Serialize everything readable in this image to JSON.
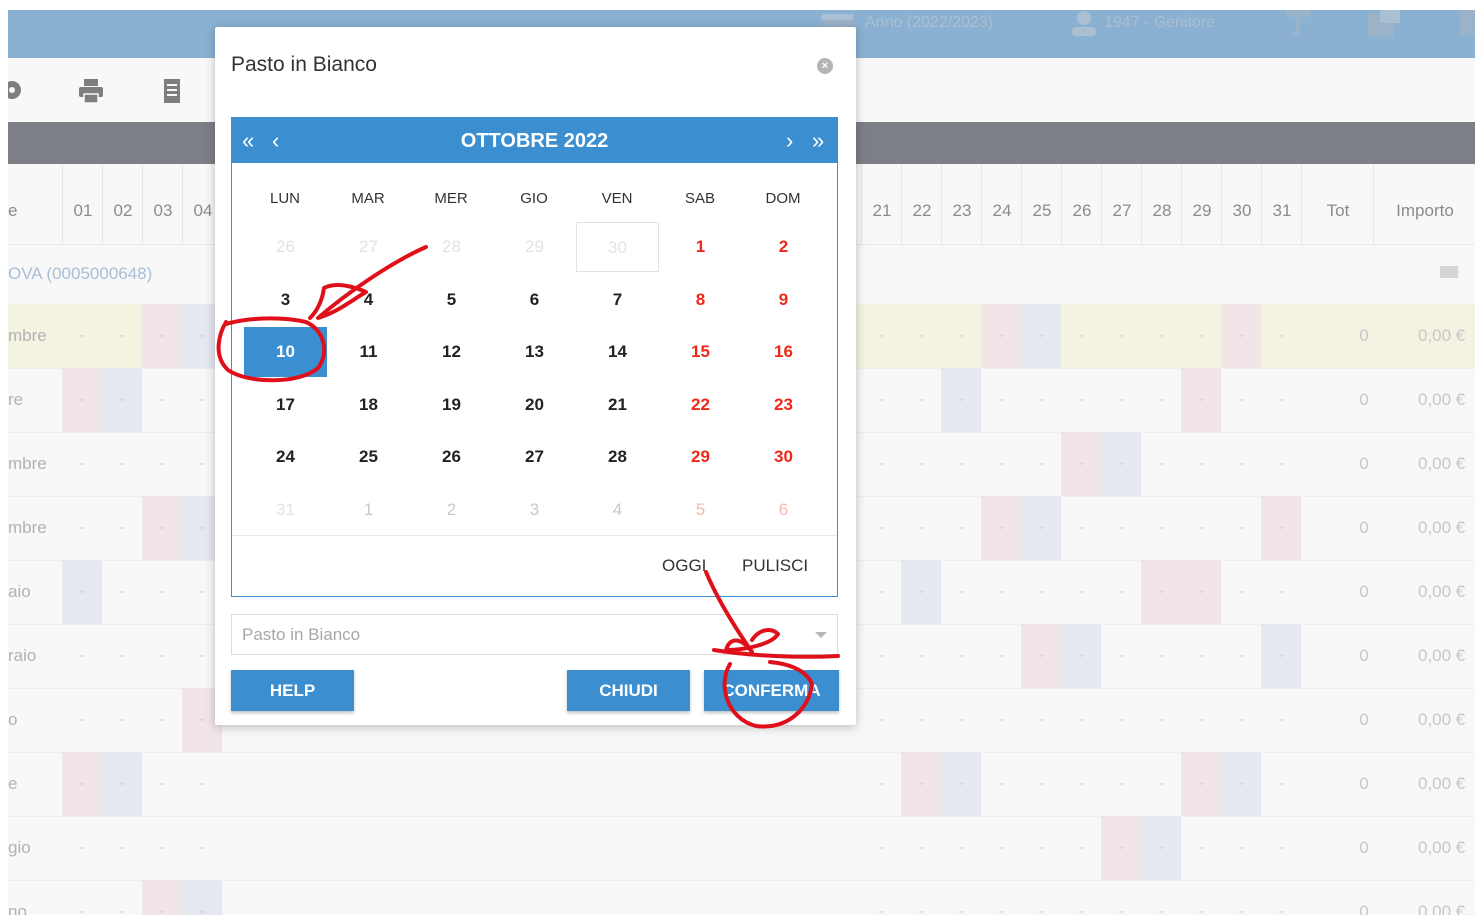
{
  "background": {
    "topbar": {
      "year": "Anno (2022/2023)",
      "user": "1947 - Genitore"
    },
    "grid": {
      "header_days": [
        "01",
        "02",
        "03",
        "04",
        "21",
        "22",
        "23",
        "24",
        "25",
        "26",
        "27",
        "28",
        "29",
        "30",
        "31"
      ],
      "header_label": "e",
      "tot_label": "Tot",
      "importo_label": "Importo",
      "student": "OVA (0005000648)",
      "rows": [
        {
          "label": "mbre",
          "tot": "0",
          "importo": "0,00 €"
        },
        {
          "label": "re",
          "tot": "0",
          "importo": "0,00 €"
        },
        {
          "label": "mbre",
          "tot": "0",
          "importo": "0,00 €"
        },
        {
          "label": "mbre",
          "tot": "0",
          "importo": "0,00 €"
        },
        {
          "label": "aio",
          "tot": "0",
          "importo": "0,00 €"
        },
        {
          "label": "raio",
          "tot": "0",
          "importo": "0,00 €"
        },
        {
          "label": "o",
          "tot": "0",
          "importo": "0,00 €"
        },
        {
          "label": "e",
          "tot": "0",
          "importo": "0,00 €"
        },
        {
          "label": "gio",
          "tot": "0",
          "importo": "0,00 €"
        },
        {
          "label": "no",
          "tot": "0",
          "importo": "0,00 €"
        }
      ],
      "dash": "-"
    }
  },
  "modal": {
    "title": "Pasto in Bianco",
    "close": "×",
    "calendar": {
      "month": "OTTOBRE 2022",
      "prev_year": "«",
      "prev_month": "‹",
      "next_month": "›",
      "next_year": "»",
      "weekdays": [
        "LUN",
        "MAR",
        "MER",
        "GIO",
        "VEN",
        "SAB",
        "DOM"
      ],
      "weeks": [
        [
          "26",
          "27",
          "28",
          "29",
          "30",
          "1",
          "2"
        ],
        [
          "3",
          "4",
          "5",
          "6",
          "7",
          "8",
          "9"
        ],
        [
          "10",
          "11",
          "12",
          "13",
          "14",
          "15",
          "16"
        ],
        [
          "17",
          "18",
          "19",
          "20",
          "21",
          "22",
          "23"
        ],
        [
          "24",
          "25",
          "26",
          "27",
          "28",
          "29",
          "30"
        ],
        [
          "31",
          "1",
          "2",
          "3",
          "4",
          "5",
          "6"
        ]
      ],
      "selected": "10",
      "today_btn": "OGGI",
      "clear_btn": "PULISCI"
    },
    "select_placeholder": "Pasto in Bianco",
    "buttons": {
      "help": "HELP",
      "close": "CHIUDI",
      "confirm": "CONFERMA"
    }
  },
  "colors": {
    "accent": "#3b8fd1",
    "weekend": "#f0281a",
    "annotation": "#e0101a"
  },
  "icons": [
    "gear-icon",
    "printer-icon",
    "document-icon",
    "calendar-icon",
    "user-icon",
    "pipe-icon",
    "expand-icon",
    "close-icon",
    "chevron-down-icon"
  ]
}
